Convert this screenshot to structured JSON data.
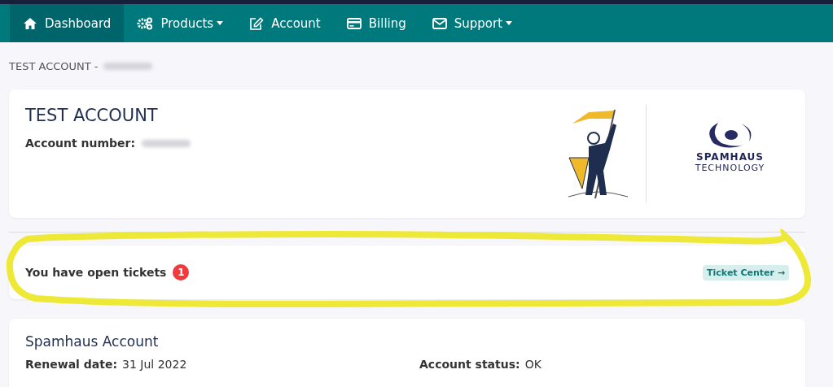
{
  "nav": {
    "items": [
      {
        "label": "Dashboard",
        "selected": true,
        "dropdown": false
      },
      {
        "label": "Products",
        "selected": false,
        "dropdown": true
      },
      {
        "label": "Account",
        "selected": false,
        "dropdown": false
      },
      {
        "label": "Billing",
        "selected": false,
        "dropdown": false
      },
      {
        "label": "Support",
        "selected": false,
        "dropdown": true
      }
    ]
  },
  "breadcrumb": "TEST ACCOUNT -",
  "account_card": {
    "title": "TEST ACCOUNT",
    "number_label": "Account number:",
    "logo": {
      "line_1": "SPAMHAUS",
      "line_2": "TECHNOLOGY"
    }
  },
  "tickets": {
    "message": "You have open tickets",
    "count": "1",
    "link": "Ticket Center →"
  },
  "spamhaus_account": {
    "title": "Spamhaus Account",
    "fields": [
      {
        "label": "Renewal date:",
        "value": "31 Jul 2022"
      },
      {
        "label": "Account status:",
        "value": "OK"
      }
    ]
  }
}
